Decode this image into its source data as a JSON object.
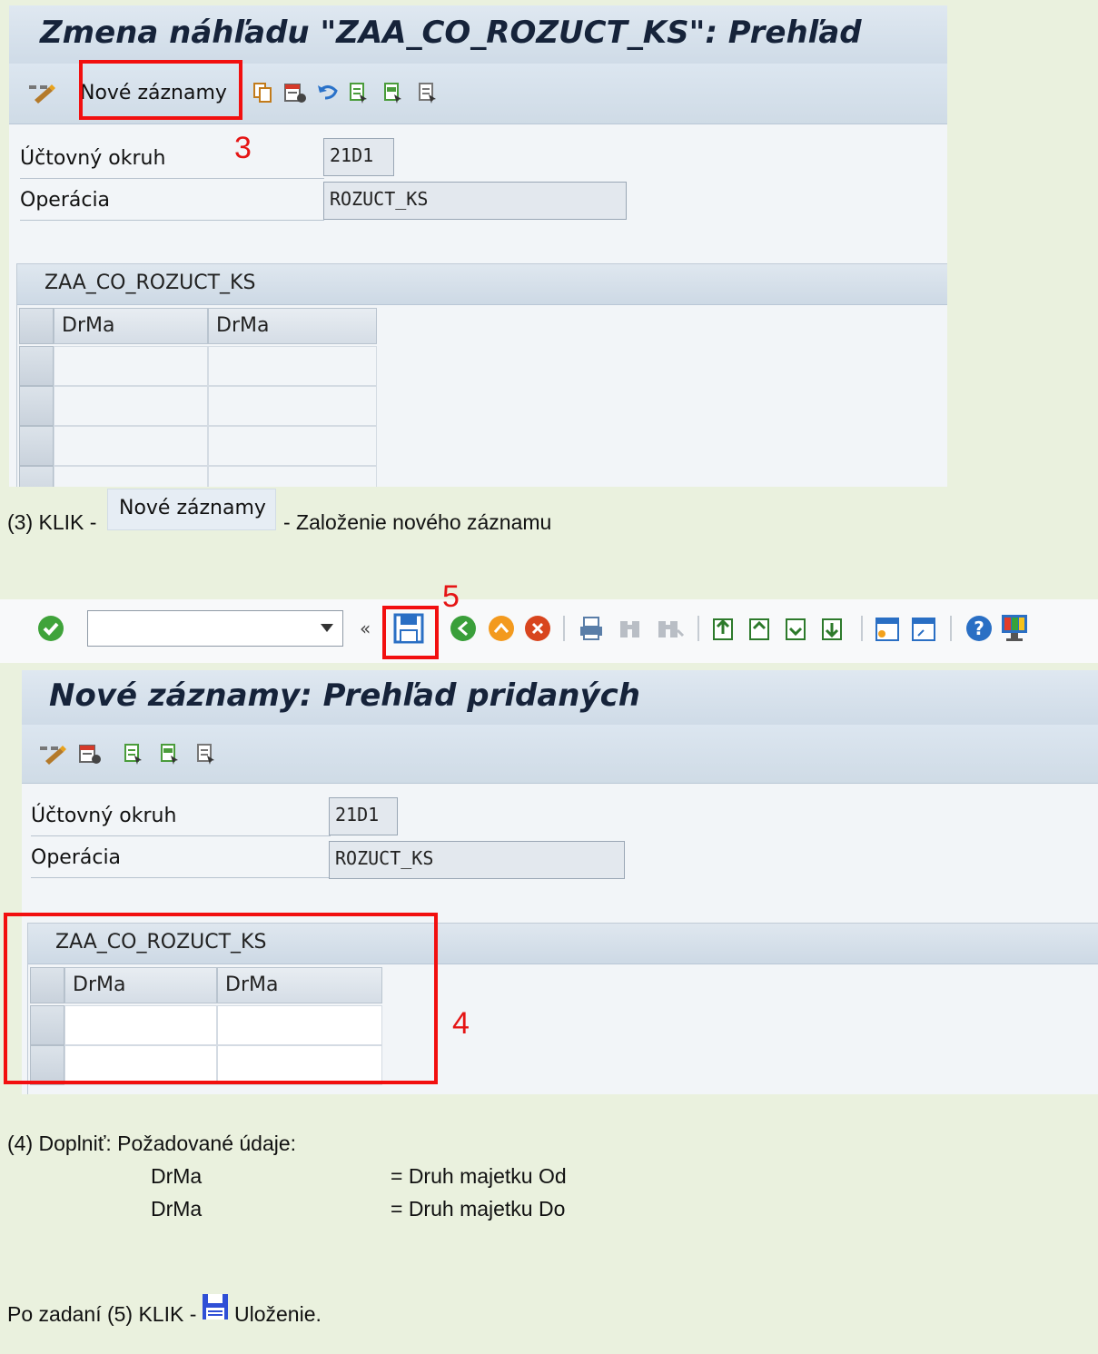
{
  "shot1": {
    "title": "Zmena náhľadu \"ZAA_CO_ROZUCT_KS\": Prehľad",
    "toolbar": {
      "new_entries_label": "Nové záznamy"
    },
    "fields": [
      {
        "label": "Účtovný okruh",
        "value": "21D1"
      },
      {
        "label": "Operácia",
        "value": "ROZUCT_KS"
      }
    ],
    "table": {
      "title": "ZAA_CO_ROZUCT_KS",
      "columns": [
        "DrMa",
        "DrMa"
      ]
    },
    "annotation": "3"
  },
  "step3": {
    "prefix": "(3) KLIK -",
    "button": "Nové záznamy",
    "suffix": "- Založenie nového záznamu"
  },
  "shot2": {
    "annotation": "5",
    "title": "Nové záznamy: Prehľad pridaných",
    "fields": [
      {
        "label": "Účtovný okruh",
        "value": "21D1"
      },
      {
        "label": "Operácia",
        "value": "ROZUCT_KS"
      }
    ],
    "table": {
      "title": "ZAA_CO_ROZUCT_KS",
      "columns": [
        "DrMa",
        "DrMa"
      ]
    },
    "table_annotation": "4"
  },
  "step4": {
    "heading": "(4) Doplniť: Požadované údaje:",
    "rows": [
      {
        "field": "DrMa",
        "desc": "= Druh majetku Od"
      },
      {
        "field": "DrMa",
        "desc": "= Druh majetku Do"
      }
    ]
  },
  "step5": {
    "prefix": "Po zadaní (5) KLIK -",
    "suffix": "Uloženie."
  },
  "colors": {
    "page_bg": "#eaf1de",
    "annotation_red": "#f20f0f"
  }
}
